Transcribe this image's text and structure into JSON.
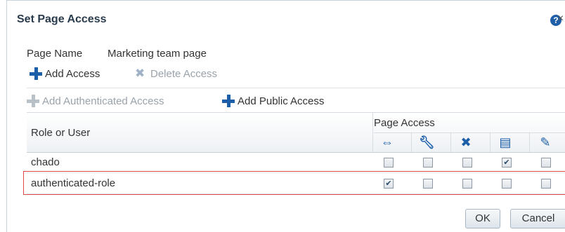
{
  "dialog": {
    "title": "Set Page Access"
  },
  "page_name": {
    "label": "Page Name",
    "value": "Marketing team page"
  },
  "toolbar": {
    "add_access": "Add Access",
    "delete_access": "Delete Access",
    "add_authenticated_access": "Add Authenticated Access",
    "add_public_access": "Add Public Access"
  },
  "table": {
    "role_header": "Role or User",
    "group_header": "Page Access",
    "permission_icons": [
      "link-icon",
      "wrench-icon",
      "delete-x-icon",
      "edit-page-icon",
      "pencil-icon"
    ],
    "rows": [
      {
        "name": "chado",
        "checks": [
          false,
          false,
          false,
          true,
          false
        ]
      },
      {
        "name": "authenticated-role",
        "checks": [
          true,
          false,
          false,
          false,
          false
        ]
      }
    ]
  },
  "buttons": {
    "ok": "OK",
    "cancel": "Cancel"
  },
  "colors": {
    "accent": "#1d5ea9",
    "highlight": "#e24848"
  }
}
